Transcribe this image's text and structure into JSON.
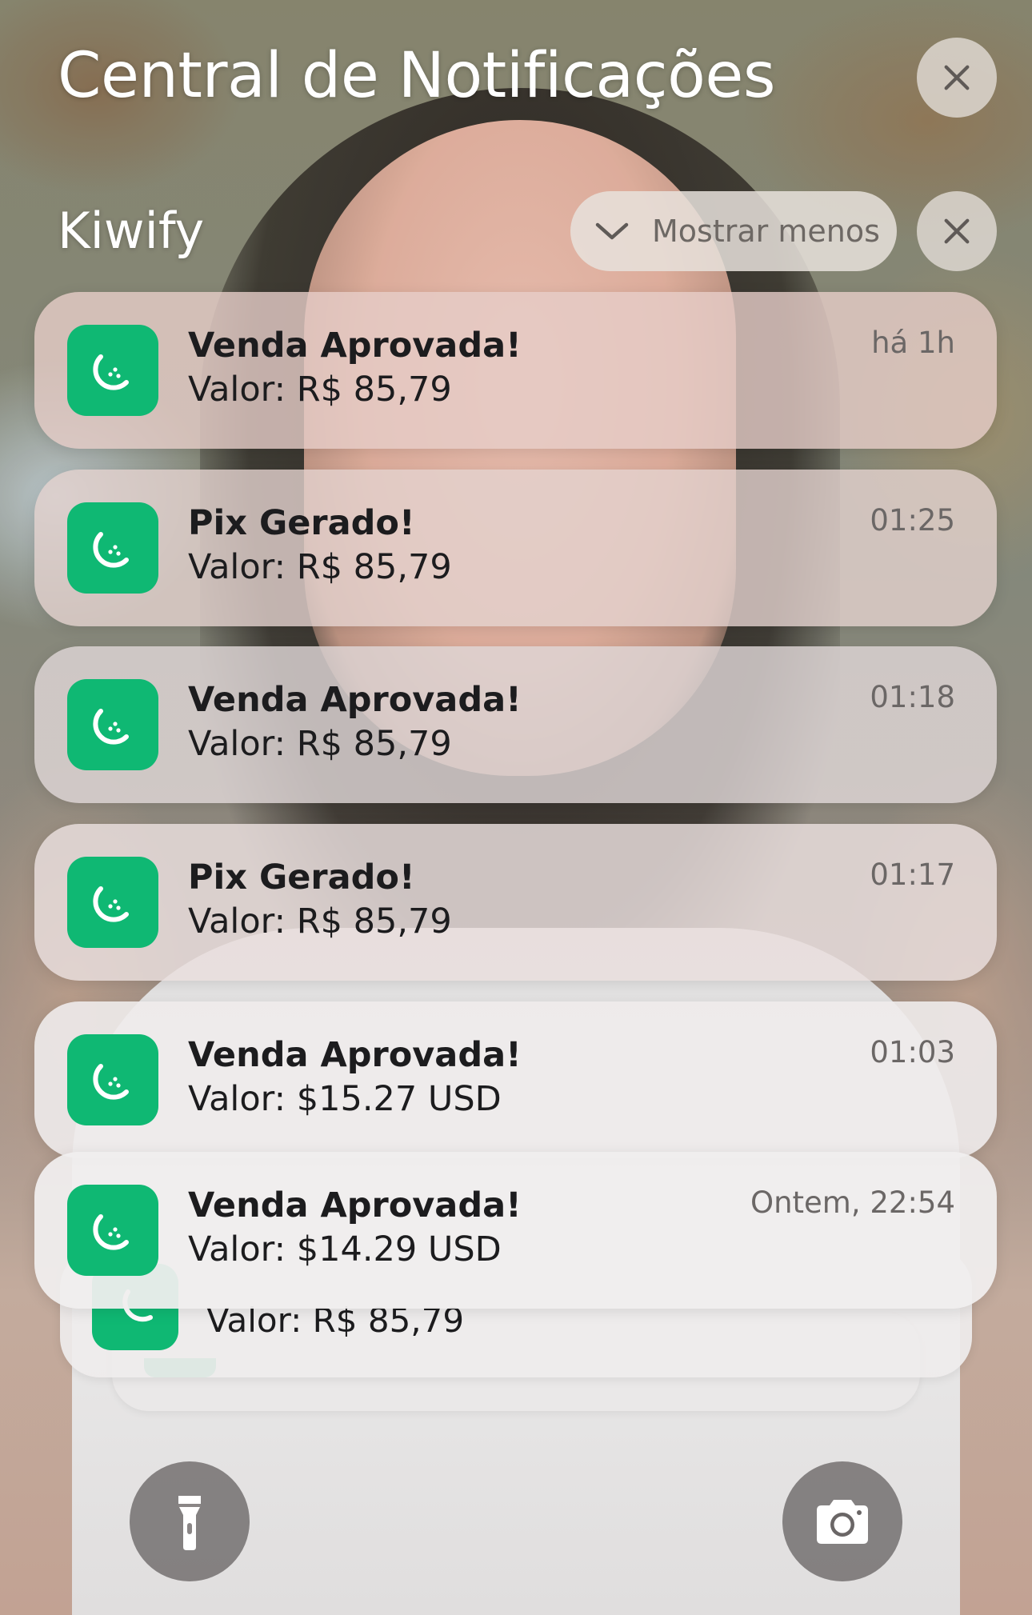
{
  "header": {
    "title": "Central de Notificações",
    "close_icon": "close-icon"
  },
  "group": {
    "app_name": "Kiwify",
    "show_less_label": "Mostrar menos",
    "chevron_icon": "chevron-down-icon",
    "close_icon": "close-icon"
  },
  "notifications": [
    {
      "title": "Venda Aprovada!",
      "body": "Valor: R$ 85,79",
      "time": "há 1h",
      "icon": "kiwify-app-icon"
    },
    {
      "title": "Pix Gerado!",
      "body": "Valor: R$ 85,79",
      "time": "01:25",
      "icon": "kiwify-app-icon"
    },
    {
      "title": "Venda Aprovada!",
      "body": "Valor: R$ 85,79",
      "time": "01:18",
      "icon": "kiwify-app-icon"
    },
    {
      "title": "Pix Gerado!",
      "body": "Valor: R$ 85,79",
      "time": "01:17",
      "icon": "kiwify-app-icon"
    },
    {
      "title": "Venda Aprovada!",
      "body": "Valor: $15.27 USD",
      "time": "01:03",
      "icon": "kiwify-app-icon"
    },
    {
      "title": "Venda Aprovada!",
      "body": "Valor: $14.29 USD",
      "time": "Ontem, 22:54",
      "icon": "kiwify-app-icon"
    }
  ],
  "stacked": {
    "body": "Valor: R$ 85,79"
  },
  "quick_actions": {
    "flashlight_icon": "flashlight-icon",
    "camera_icon": "camera-icon"
  },
  "colors": {
    "app_green": "#0fb873",
    "text_dark": "#1c1c1e",
    "time_gray": "#6b6766"
  }
}
